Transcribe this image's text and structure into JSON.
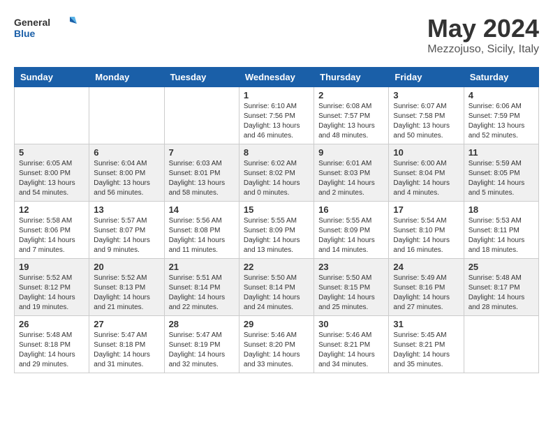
{
  "header": {
    "logo_general": "General",
    "logo_blue": "Blue",
    "month_title": "May 2024",
    "location": "Mezzojuso, Sicily, Italy"
  },
  "weekdays": [
    "Sunday",
    "Monday",
    "Tuesday",
    "Wednesday",
    "Thursday",
    "Friday",
    "Saturday"
  ],
  "weeks": [
    [
      {
        "day": "",
        "sunrise": "",
        "sunset": "",
        "daylight": ""
      },
      {
        "day": "",
        "sunrise": "",
        "sunset": "",
        "daylight": ""
      },
      {
        "day": "",
        "sunrise": "",
        "sunset": "",
        "daylight": ""
      },
      {
        "day": "1",
        "sunrise": "Sunrise: 6:10 AM",
        "sunset": "Sunset: 7:56 PM",
        "daylight": "Daylight: 13 hours and 46 minutes."
      },
      {
        "day": "2",
        "sunrise": "Sunrise: 6:08 AM",
        "sunset": "Sunset: 7:57 PM",
        "daylight": "Daylight: 13 hours and 48 minutes."
      },
      {
        "day": "3",
        "sunrise": "Sunrise: 6:07 AM",
        "sunset": "Sunset: 7:58 PM",
        "daylight": "Daylight: 13 hours and 50 minutes."
      },
      {
        "day": "4",
        "sunrise": "Sunrise: 6:06 AM",
        "sunset": "Sunset: 7:59 PM",
        "daylight": "Daylight: 13 hours and 52 minutes."
      }
    ],
    [
      {
        "day": "5",
        "sunrise": "Sunrise: 6:05 AM",
        "sunset": "Sunset: 8:00 PM",
        "daylight": "Daylight: 13 hours and 54 minutes."
      },
      {
        "day": "6",
        "sunrise": "Sunrise: 6:04 AM",
        "sunset": "Sunset: 8:00 PM",
        "daylight": "Daylight: 13 hours and 56 minutes."
      },
      {
        "day": "7",
        "sunrise": "Sunrise: 6:03 AM",
        "sunset": "Sunset: 8:01 PM",
        "daylight": "Daylight: 13 hours and 58 minutes."
      },
      {
        "day": "8",
        "sunrise": "Sunrise: 6:02 AM",
        "sunset": "Sunset: 8:02 PM",
        "daylight": "Daylight: 14 hours and 0 minutes."
      },
      {
        "day": "9",
        "sunrise": "Sunrise: 6:01 AM",
        "sunset": "Sunset: 8:03 PM",
        "daylight": "Daylight: 14 hours and 2 minutes."
      },
      {
        "day": "10",
        "sunrise": "Sunrise: 6:00 AM",
        "sunset": "Sunset: 8:04 PM",
        "daylight": "Daylight: 14 hours and 4 minutes."
      },
      {
        "day": "11",
        "sunrise": "Sunrise: 5:59 AM",
        "sunset": "Sunset: 8:05 PM",
        "daylight": "Daylight: 14 hours and 5 minutes."
      }
    ],
    [
      {
        "day": "12",
        "sunrise": "Sunrise: 5:58 AM",
        "sunset": "Sunset: 8:06 PM",
        "daylight": "Daylight: 14 hours and 7 minutes."
      },
      {
        "day": "13",
        "sunrise": "Sunrise: 5:57 AM",
        "sunset": "Sunset: 8:07 PM",
        "daylight": "Daylight: 14 hours and 9 minutes."
      },
      {
        "day": "14",
        "sunrise": "Sunrise: 5:56 AM",
        "sunset": "Sunset: 8:08 PM",
        "daylight": "Daylight: 14 hours and 11 minutes."
      },
      {
        "day": "15",
        "sunrise": "Sunrise: 5:55 AM",
        "sunset": "Sunset: 8:09 PM",
        "daylight": "Daylight: 14 hours and 13 minutes."
      },
      {
        "day": "16",
        "sunrise": "Sunrise: 5:55 AM",
        "sunset": "Sunset: 8:09 PM",
        "daylight": "Daylight: 14 hours and 14 minutes."
      },
      {
        "day": "17",
        "sunrise": "Sunrise: 5:54 AM",
        "sunset": "Sunset: 8:10 PM",
        "daylight": "Daylight: 14 hours and 16 minutes."
      },
      {
        "day": "18",
        "sunrise": "Sunrise: 5:53 AM",
        "sunset": "Sunset: 8:11 PM",
        "daylight": "Daylight: 14 hours and 18 minutes."
      }
    ],
    [
      {
        "day": "19",
        "sunrise": "Sunrise: 5:52 AM",
        "sunset": "Sunset: 8:12 PM",
        "daylight": "Daylight: 14 hours and 19 minutes."
      },
      {
        "day": "20",
        "sunrise": "Sunrise: 5:52 AM",
        "sunset": "Sunset: 8:13 PM",
        "daylight": "Daylight: 14 hours and 21 minutes."
      },
      {
        "day": "21",
        "sunrise": "Sunrise: 5:51 AM",
        "sunset": "Sunset: 8:14 PM",
        "daylight": "Daylight: 14 hours and 22 minutes."
      },
      {
        "day": "22",
        "sunrise": "Sunrise: 5:50 AM",
        "sunset": "Sunset: 8:14 PM",
        "daylight": "Daylight: 14 hours and 24 minutes."
      },
      {
        "day": "23",
        "sunrise": "Sunrise: 5:50 AM",
        "sunset": "Sunset: 8:15 PM",
        "daylight": "Daylight: 14 hours and 25 minutes."
      },
      {
        "day": "24",
        "sunrise": "Sunrise: 5:49 AM",
        "sunset": "Sunset: 8:16 PM",
        "daylight": "Daylight: 14 hours and 27 minutes."
      },
      {
        "day": "25",
        "sunrise": "Sunrise: 5:48 AM",
        "sunset": "Sunset: 8:17 PM",
        "daylight": "Daylight: 14 hours and 28 minutes."
      }
    ],
    [
      {
        "day": "26",
        "sunrise": "Sunrise: 5:48 AM",
        "sunset": "Sunset: 8:18 PM",
        "daylight": "Daylight: 14 hours and 29 minutes."
      },
      {
        "day": "27",
        "sunrise": "Sunrise: 5:47 AM",
        "sunset": "Sunset: 8:18 PM",
        "daylight": "Daylight: 14 hours and 31 minutes."
      },
      {
        "day": "28",
        "sunrise": "Sunrise: 5:47 AM",
        "sunset": "Sunset: 8:19 PM",
        "daylight": "Daylight: 14 hours and 32 minutes."
      },
      {
        "day": "29",
        "sunrise": "Sunrise: 5:46 AM",
        "sunset": "Sunset: 8:20 PM",
        "daylight": "Daylight: 14 hours and 33 minutes."
      },
      {
        "day": "30",
        "sunrise": "Sunrise: 5:46 AM",
        "sunset": "Sunset: 8:21 PM",
        "daylight": "Daylight: 14 hours and 34 minutes."
      },
      {
        "day": "31",
        "sunrise": "Sunrise: 5:45 AM",
        "sunset": "Sunset: 8:21 PM",
        "daylight": "Daylight: 14 hours and 35 minutes."
      },
      {
        "day": "",
        "sunrise": "",
        "sunset": "",
        "daylight": ""
      }
    ]
  ]
}
